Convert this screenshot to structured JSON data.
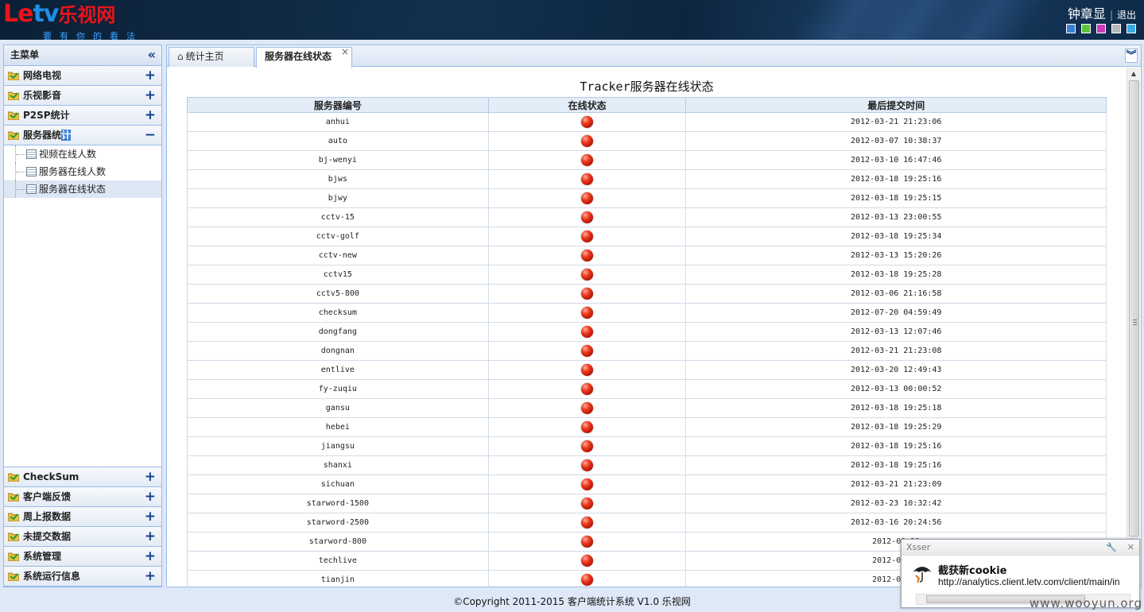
{
  "header": {
    "logo_a": "Le",
    "logo_b": "tv",
    "logo_cn": "乐视网",
    "slogan": "要有你的看法",
    "user_name": "钟章显",
    "separator": "|",
    "logout_label": "退出",
    "theme_swatches": [
      "#3a7fd4",
      "#5cc43c",
      "#d03ab8",
      "#b8b8b8",
      "#38a8e8"
    ]
  },
  "sidebar": {
    "title": "主菜单",
    "groups_top": [
      {
        "label": "网络电视",
        "toggle": "+"
      },
      {
        "label": "乐视影音",
        "toggle": "+"
      },
      {
        "label": "P2SP统计",
        "toggle": "+"
      }
    ],
    "expanded_group": {
      "label_a": "服务器统",
      "label_b": "计",
      "toggle": "−"
    },
    "sub_items": [
      {
        "label": "视频在线人数"
      },
      {
        "label": "服务器在线人数"
      },
      {
        "label": "服务器在线状态"
      }
    ],
    "groups_bottom": [
      {
        "label": "CheckSum",
        "toggle": "+"
      },
      {
        "label": "客户端反馈",
        "toggle": "+"
      },
      {
        "label": "周上报数据",
        "toggle": "+"
      },
      {
        "label": "未提交数据",
        "toggle": "+"
      },
      {
        "label": "系统管理",
        "toggle": "+"
      },
      {
        "label": "系统运行信息",
        "toggle": "+"
      }
    ]
  },
  "tabs": {
    "home_label": "统计主页",
    "active_label": "服务器在线状态",
    "close": "×"
  },
  "page": {
    "title": "Tracker服务器在线状态",
    "columns": [
      "服务器编号",
      "在线状态",
      "最后提交时间"
    ],
    "rows": [
      {
        "id": "anhui",
        "time": "2012-03-21 21:23:06"
      },
      {
        "id": "auto",
        "time": "2012-03-07 10:38:37"
      },
      {
        "id": "bj-wenyi",
        "time": "2012-03-10 16:47:46"
      },
      {
        "id": "bjws",
        "time": "2012-03-18 19:25:16"
      },
      {
        "id": "bjwy",
        "time": "2012-03-18 19:25:15"
      },
      {
        "id": "cctv-15",
        "time": "2012-03-13 23:00:55"
      },
      {
        "id": "cctv-golf",
        "time": "2012-03-18 19:25:34"
      },
      {
        "id": "cctv-new",
        "time": "2012-03-13 15:20:26"
      },
      {
        "id": "cctv15",
        "time": "2012-03-18 19:25:28"
      },
      {
        "id": "cctv5-800",
        "time": "2012-03-06 21:16:58"
      },
      {
        "id": "checksum",
        "time": "2012-07-20 04:59:49"
      },
      {
        "id": "dongfang",
        "time": "2012-03-13 12:07:46"
      },
      {
        "id": "dongnan",
        "time": "2012-03-21 21:23:08"
      },
      {
        "id": "entlive",
        "time": "2012-03-20 12:49:43"
      },
      {
        "id": "fy-zuqiu",
        "time": "2012-03-13 00:00:52"
      },
      {
        "id": "gansu",
        "time": "2012-03-18 19:25:18"
      },
      {
        "id": "hebei",
        "time": "2012-03-18 19:25:29"
      },
      {
        "id": "jiangsu",
        "time": "2012-03-18 19:25:16"
      },
      {
        "id": "shanxi",
        "time": "2012-03-18 19:25:16"
      },
      {
        "id": "sichuan",
        "time": "2012-03-21 21:23:09"
      },
      {
        "id": "starword-1500",
        "time": "2012-03-23 10:32:42"
      },
      {
        "id": "starword-2500",
        "time": "2012-03-16 20:24:56"
      },
      {
        "id": "starword-800",
        "time": "2012-03-23"
      },
      {
        "id": "techlive",
        "time": "2012-03-22"
      },
      {
        "id": "tianjin",
        "time": "2012-03-19"
      }
    ],
    "status_color": "#e02a10"
  },
  "footer": {
    "copyright": "©Copyright 2011-2015 客户端统计系统 V1.0 乐视网"
  },
  "popup": {
    "app": "Xsser",
    "title": "截获新cookie",
    "url": "http://analytics.client.letv.com/client/main/in"
  },
  "watermark": "www.wooyun.org"
}
